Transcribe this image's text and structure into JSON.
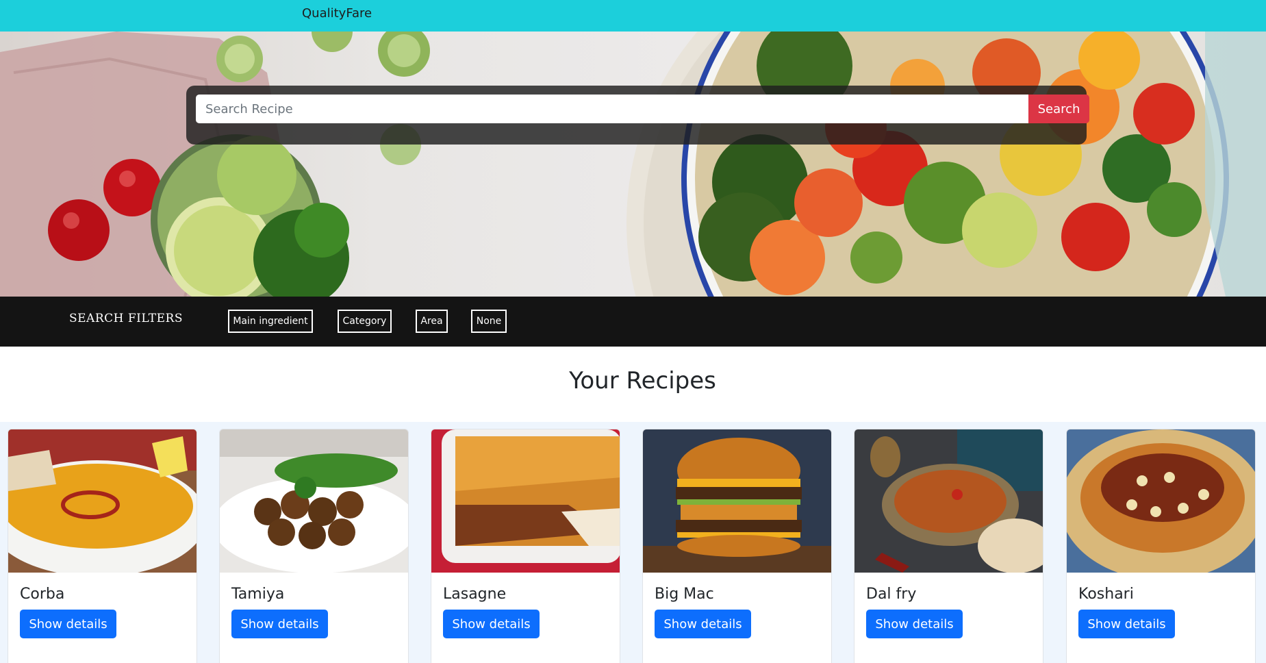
{
  "navbar": {
    "brand": "QualityFare"
  },
  "search": {
    "placeholder": "Search Recipe",
    "value": "",
    "button_label": "Search"
  },
  "filters": {
    "title": "SEARCH FILTERS",
    "options": [
      "Main ingredient",
      "Category",
      "Area",
      "None"
    ]
  },
  "recipes_section": {
    "title": "Your Recipes",
    "cards": [
      {
        "title": "Corba",
        "button_label": "Show details"
      },
      {
        "title": "Tamiya",
        "button_label": "Show details"
      },
      {
        "title": "Lasagne",
        "button_label": "Show details"
      },
      {
        "title": "Big Mac",
        "button_label": "Show details"
      },
      {
        "title": "Dal fry",
        "button_label": "Show details"
      },
      {
        "title": "Koshari",
        "button_label": "Show details"
      }
    ]
  },
  "colors": {
    "navbar": "#1ccfdb",
    "search_button": "#dc3545",
    "filter_bar": "#141414",
    "card_button": "#0d6efd"
  }
}
